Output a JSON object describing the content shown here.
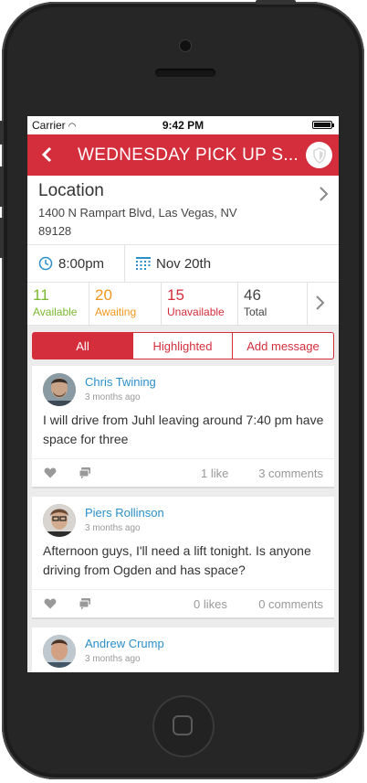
{
  "status_bar": {
    "carrier": "Carrier",
    "time": "9:42 PM"
  },
  "nav": {
    "title": "WEDNESDAY PICK UP S...",
    "back_icon": "chevron-left-icon",
    "action_icon": "shield-icon"
  },
  "location": {
    "label": "Location",
    "address_line1": "1400 N Rampart Blvd, Las Vegas, NV",
    "address_line2": "89128"
  },
  "schedule": {
    "time": "8:00pm",
    "date": "Nov 20th"
  },
  "stats": [
    {
      "count": "11",
      "label": "Available",
      "color": "#7cb82f"
    },
    {
      "count": "20",
      "label": "Awaiting",
      "color": "#f0961e"
    },
    {
      "count": "15",
      "label": "Unavailable",
      "color": "#d42e3c"
    },
    {
      "count": "46",
      "label": "Total",
      "color": "#444444"
    }
  ],
  "filters": {
    "all": "All",
    "highlighted": "Highlighted",
    "add_message": "Add message",
    "active": "All"
  },
  "posts": [
    {
      "author": "Chris Twining",
      "ago": "3 months ago",
      "body": "I will drive from Juhl leaving around 7:40 pm have space for three",
      "likes": "1 like",
      "comments": "3 comments"
    },
    {
      "author": "Piers Rollinson",
      "ago": "3 months ago",
      "body": "Afternoon guys, I'll need a lift tonight. Is anyone driving from Ogden and has space?",
      "likes": "0 likes",
      "comments": "0 comments"
    },
    {
      "author": "Andrew Crump",
      "ago": "3 months ago",
      "body": "",
      "likes": "",
      "comments": ""
    }
  ],
  "colors": {
    "brand": "#d42e3c",
    "link": "#2b8fc9"
  }
}
